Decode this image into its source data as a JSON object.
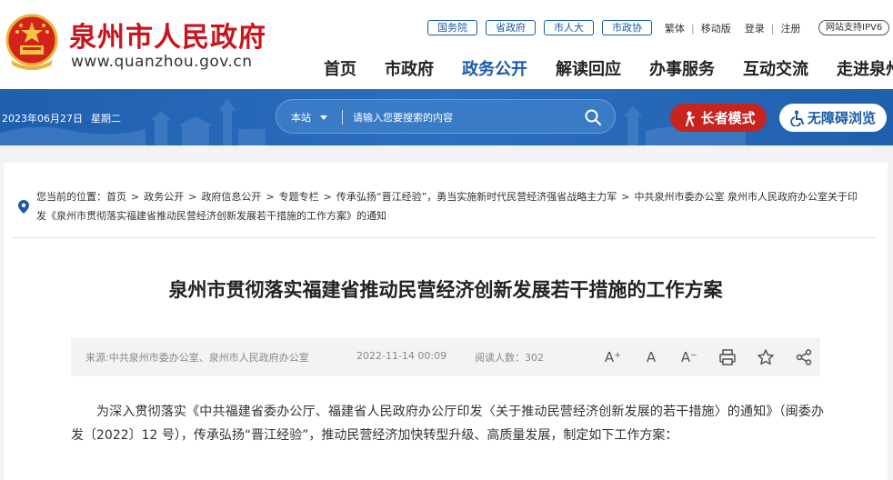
{
  "site": {
    "name": "泉州市人民政府",
    "url": "www.quanzhou.gov.cn"
  },
  "top_links": [
    "国务院",
    "省政府",
    "市人大",
    "市政协"
  ],
  "utility": {
    "traditional": "繁体",
    "mobile": "移动版",
    "login": "登录",
    "register": "注册",
    "ipv6": "网站支持IPV6"
  },
  "nav": [
    "首页",
    "市政府",
    "政务公开",
    "解读回应",
    "办事服务",
    "互动交流",
    "走进泉州"
  ],
  "nav_active": "政务公开",
  "banner": {
    "date": "2023年06月27日",
    "weekday": "星期二",
    "search_scope": "本站",
    "search_placeholder": "请输入您要搜索的内容",
    "elder_mode": "长者模式",
    "accessibility": "无障碍浏览"
  },
  "breadcrumb": {
    "prefix": "您当前的位置：",
    "items": [
      "首页",
      "政务公开",
      "政府信息公开",
      "专题专栏",
      "传承弘扬“晋江经验”，勇当实施新时代民营经济强省战略主力军",
      "中共泉州市委办公室 泉州市人民政府办公室关于印发《泉州市贯彻落实福建省推动民营经济创新发展若干措施的工作方案》的通知"
    ]
  },
  "article": {
    "title": "泉州市贯彻落实福建省推动民营经济创新发展若干措施的工作方案",
    "source": "来源:中共泉州市委办公室、泉州市人民政府办公室",
    "datetime": "2022-11-14 00:09",
    "views_label": "阅读人数：",
    "views": "302",
    "body": "为深入贯彻落实《中共福建省委办公厅、福建省人民政府办公厅印发〈关于推动民营经济创新发展的若干措施〉的通知》（闽委办发〔2022〕12 号），传承弘扬“晋江经验”，推动民营经济加快转型升级、高质量发展，制定如下工作方案："
  },
  "tools": {
    "font_larger": "A⁺",
    "font_normal": "A",
    "font_smaller": "A⁻"
  },
  "colors": {
    "brand_red": "#c8151d",
    "brand_blue": "#1a5aa6"
  }
}
